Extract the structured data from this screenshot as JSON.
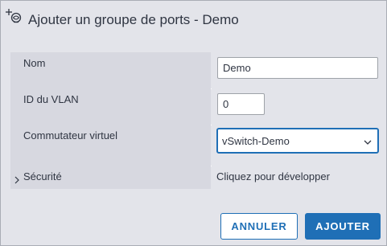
{
  "dialog": {
    "title": "Ajouter un groupe de ports - Demo",
    "title_icon": "add-port-group-icon"
  },
  "form": {
    "name": {
      "label": "Nom",
      "value": "Demo"
    },
    "vlan": {
      "label": "ID du VLAN",
      "value": "0"
    },
    "vswitch": {
      "label": "Commutateur virtuel",
      "selected": "vSwitch-Demo",
      "icon": "chevron-down-icon"
    },
    "security": {
      "label": "Sécurité",
      "hint": "Cliquez pour développer",
      "icon": "chevron-right-icon"
    }
  },
  "buttons": {
    "cancel_label": "ANNULER",
    "add_label": "AJOUTER"
  },
  "colors": {
    "accent": "#1f6fb6",
    "panel_background": "#e3e4ea",
    "label_cell_background": "#d7d8e0",
    "text": "#2f3542"
  }
}
